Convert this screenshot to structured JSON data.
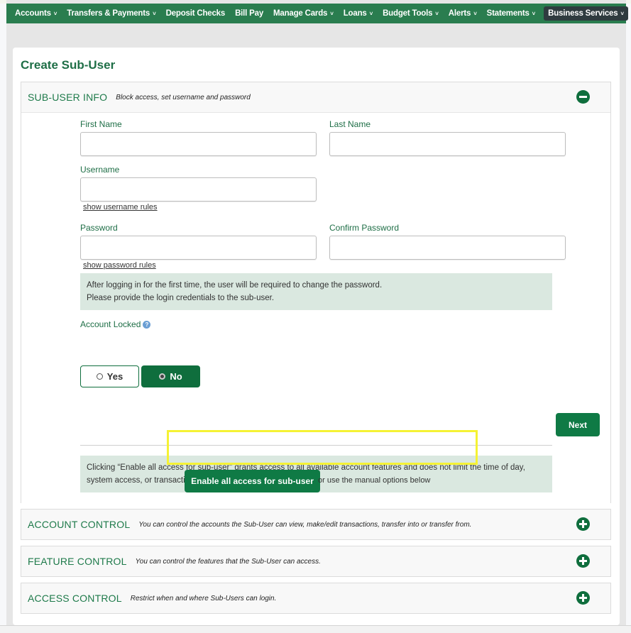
{
  "nav": {
    "items": [
      {
        "label": "Accounts",
        "dropdown": true
      },
      {
        "label": "Transfers & Payments",
        "dropdown": true
      },
      {
        "label": "Deposit Checks",
        "dropdown": false
      },
      {
        "label": "Bill Pay",
        "dropdown": false
      },
      {
        "label": "Manage Cards",
        "dropdown": true
      },
      {
        "label": "Loans",
        "dropdown": true
      },
      {
        "label": "Budget Tools",
        "dropdown": true
      },
      {
        "label": "Alerts",
        "dropdown": true
      },
      {
        "label": "Statements",
        "dropdown": true
      },
      {
        "label": "Business Services",
        "dropdown": true,
        "active": true
      }
    ],
    "chevron": "˅"
  },
  "page": {
    "title": "Create Sub-User"
  },
  "sub_user_info": {
    "title": "SUB-USER INFO",
    "subtitle": "Block access, set username and password",
    "icon": "minus-circle-icon",
    "first_name_label": "First Name",
    "first_name_value": "",
    "last_name_label": "Last Name",
    "last_name_value": "",
    "username_label": "Username",
    "username_value": "",
    "username_rules_link": "show username rules",
    "password_label": "Password",
    "password_value": "",
    "confirm_password_label": "Confirm Password",
    "confirm_password_value": "",
    "password_rules_link": "show password rules",
    "password_info_line1": "After logging in for the first time, the user will be required to change the password.",
    "password_info_line2": "Please provide the login credentials to the sub-user.",
    "account_locked_label": "Account Locked",
    "account_locked_help": "?",
    "yes_label": "Yes",
    "no_label": "No",
    "account_locked_selected": "No",
    "next_label": "Next",
    "enable_info": "Clicking “Enable all access for sub-user” grants access to all available account features and does not limit the time of day, system access, or transactions the sub-user can perform.",
    "enable_button": "Enable all access for sub-user",
    "manual_text": "or use the manual options below"
  },
  "sections": [
    {
      "title": "ACCOUNT CONTROL",
      "subtitle": "You can control the accounts the Sub-User can view, make/edit transactions, transfer into or transfer from.",
      "icon": "plus-circle-icon"
    },
    {
      "title": "FEATURE CONTROL",
      "subtitle": "You can control the features that the Sub-User can access.",
      "icon": "plus-circle-icon"
    },
    {
      "title": "ACCESS CONTROL",
      "subtitle": "Restrict when and where Sub-Users can login.",
      "icon": "plus-circle-icon"
    }
  ],
  "colors": {
    "brand_green": "#0f7a45",
    "nav_green": "#2a7d4f",
    "active_nav": "#2f3b3f",
    "info_bg": "#dae8e0",
    "highlight": "#f5f234"
  }
}
